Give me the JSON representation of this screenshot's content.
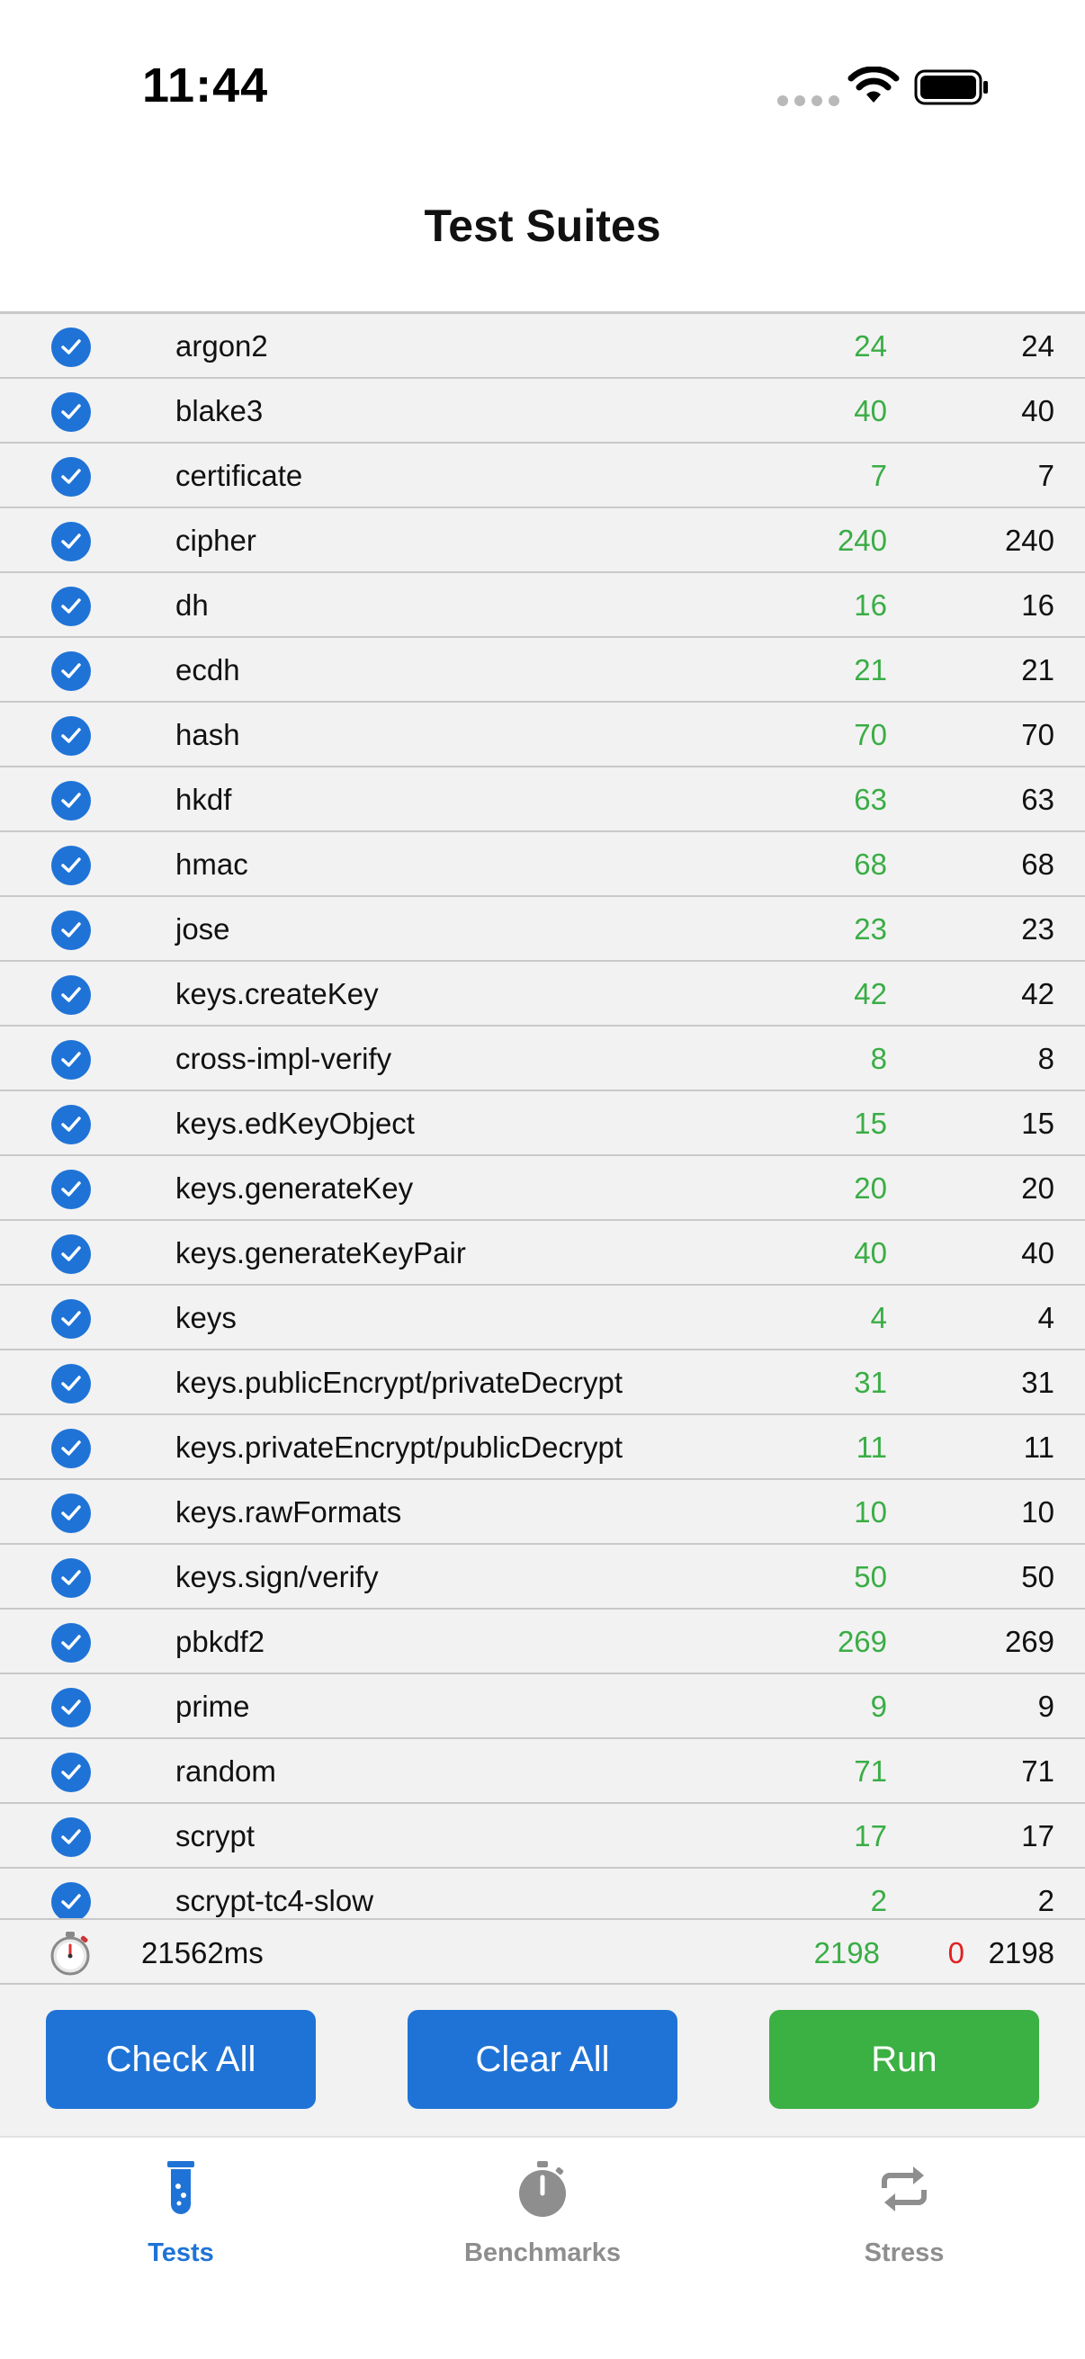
{
  "status_bar": {
    "time": "11:44"
  },
  "nav": {
    "title": "Test Suites"
  },
  "suites": [
    {
      "name": "argon2",
      "passed": "24",
      "total": "24"
    },
    {
      "name": "blake3",
      "passed": "40",
      "total": "40"
    },
    {
      "name": "certificate",
      "passed": "7",
      "total": "7"
    },
    {
      "name": "cipher",
      "passed": "240",
      "total": "240"
    },
    {
      "name": "dh",
      "passed": "16",
      "total": "16"
    },
    {
      "name": "ecdh",
      "passed": "21",
      "total": "21"
    },
    {
      "name": "hash",
      "passed": "70",
      "total": "70"
    },
    {
      "name": "hkdf",
      "passed": "63",
      "total": "63"
    },
    {
      "name": "hmac",
      "passed": "68",
      "total": "68"
    },
    {
      "name": "jose",
      "passed": "23",
      "total": "23"
    },
    {
      "name": "keys.createKey",
      "passed": "42",
      "total": "42"
    },
    {
      "name": "cross-impl-verify",
      "passed": "8",
      "total": "8"
    },
    {
      "name": "keys.edKeyObject",
      "passed": "15",
      "total": "15"
    },
    {
      "name": "keys.generateKey",
      "passed": "20",
      "total": "20"
    },
    {
      "name": "keys.generateKeyPair",
      "passed": "40",
      "total": "40"
    },
    {
      "name": "keys",
      "passed": "4",
      "total": "4"
    },
    {
      "name": "keys.publicEncrypt/privateDecrypt",
      "passed": "31",
      "total": "31"
    },
    {
      "name": "keys.privateEncrypt/publicDecrypt",
      "passed": "11",
      "total": "11"
    },
    {
      "name": "keys.rawFormats",
      "passed": "10",
      "total": "10"
    },
    {
      "name": "keys.sign/verify",
      "passed": "50",
      "total": "50"
    },
    {
      "name": "pbkdf2",
      "passed": "269",
      "total": "269"
    },
    {
      "name": "prime",
      "passed": "9",
      "total": "9"
    },
    {
      "name": "random",
      "passed": "71",
      "total": "71"
    },
    {
      "name": "scrypt",
      "passed": "17",
      "total": "17"
    },
    {
      "name": "scrypt-tc4-slow",
      "passed": "2",
      "total": "2"
    }
  ],
  "summary": {
    "elapsed": "21562ms",
    "passed": "2198",
    "failed": "0",
    "total": "2198"
  },
  "buttons": {
    "check_all": "Check All",
    "clear_all": "Clear All",
    "run": "Run"
  },
  "tabs": [
    {
      "label": "Tests",
      "icon": "test-tube-icon",
      "active": true
    },
    {
      "label": "Benchmarks",
      "icon": "stopwatch-icon",
      "active": false
    },
    {
      "label": "Stress",
      "icon": "repeat-icon",
      "active": false
    }
  ],
  "colors": {
    "accent_blue": "#1f73d6",
    "pass_green": "#3aad45",
    "run_green": "#3bb043",
    "fail_red": "#e02020",
    "inactive_gray": "#8e8e8e"
  }
}
